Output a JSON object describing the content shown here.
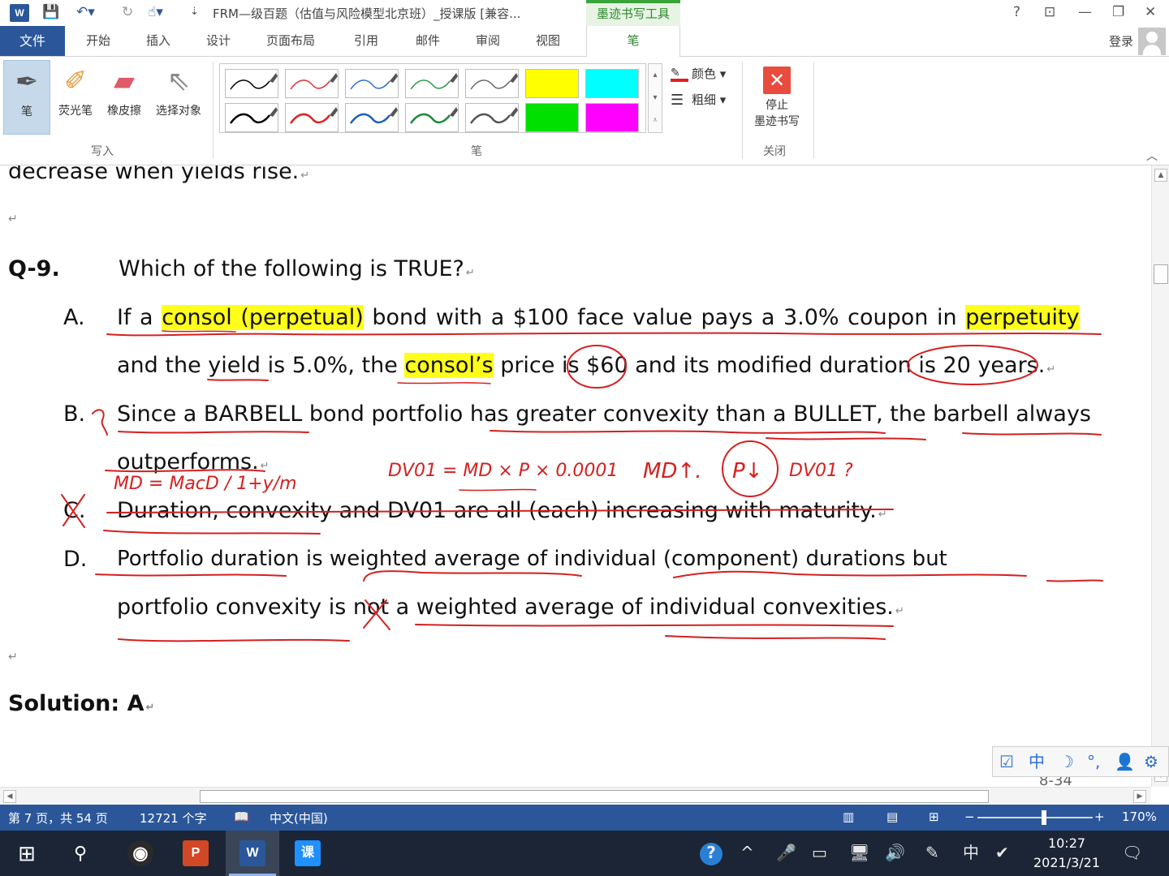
{
  "titlebar": {
    "app_icon": "W",
    "title": "FRM—级百题（估值与风险模型北京班）_授课版 [兼容...",
    "context_tab": "墨迹书写工具",
    "help": "?",
    "ribbon_options": "⊡",
    "minimize": "—",
    "restore": "❐",
    "close": "✕"
  },
  "tabs": {
    "file": "文件",
    "items": [
      "开始",
      "插入",
      "设计",
      "页面布局",
      "引用",
      "邮件",
      "审阅",
      "视图"
    ],
    "active": "笔",
    "signin": "登录"
  },
  "ribbon": {
    "write_tools": [
      {
        "label": "笔",
        "icon": "pen-icon"
      },
      {
        "label": "荧光笔",
        "icon": "highlighter-icon"
      },
      {
        "label": "橡皮擦",
        "icon": "eraser-icon"
      },
      {
        "label": "选择对象",
        "icon": "select-cursor-icon"
      }
    ],
    "write_group": "写入",
    "pens_group": "笔",
    "pen_colors_top": [
      "#000000",
      "#e03030",
      "#2f6fd0",
      "#2f9a4a",
      "#6a6a6a"
    ],
    "pen_colors_bottom": [
      "#000000",
      "#e02020",
      "#1f5fbf",
      "#1a8a3a",
      "#555555"
    ],
    "highlighters_top": [
      "#ffff00",
      "#00ffff"
    ],
    "highlighters_bottom": [
      "#00e000",
      "#ff00ff"
    ],
    "color_cmd": "颜色",
    "thickness_cmd": "粗细",
    "stop_line1": "停止",
    "stop_line2": "墨迹书写",
    "close_group": "关闭"
  },
  "document": {
    "line_prev": "decrease when yields rise.",
    "q_label": "Q-9.",
    "q_text": "Which of the following is TRUE?",
    "a_label": "A.",
    "a1_pre": "If a ",
    "a1_hl1": "consol (perpetual)",
    "a1_mid": " bond with a $100 face value pays a 3.0% coupon in ",
    "a1_hl2": "perpetuity",
    "a2_pre": "and the yield is 5.0%, the ",
    "a2_hl": "consol’s",
    "a2_post": " price is $60 and its modified duration is 20 years.",
    "b_label": "B.",
    "b1": "Since a BARBELL bond portfolio has greater convexity than a BULLET, the barbell always",
    "b2": "outperforms.",
    "c_label": "C.",
    "c1": "Duration, convexity and DV01 are all (each) increasing with maturity.",
    "d_label": "D.",
    "d1": "Portfolio  duration  is  weighted  average  of  individual  (component)  durations  but",
    "d2": "portfolio convexity is not a weighted average of individual convexities.",
    "solution": "Solution: A",
    "page_fragment": "8-34",
    "handwriting": {
      "note1": "MD = MacD / 1+y/m",
      "note2": "DV01 = MD × P × 0.0001",
      "note3": "MD↑.",
      "note4": "P↓",
      "note5": "DV01 ?"
    }
  },
  "ime": {
    "items": [
      "☑",
      "中",
      "☽",
      "°,",
      "👤",
      "⚙"
    ]
  },
  "statusbar": {
    "page": "第 7 页，共 54 页",
    "words": "12721 个字",
    "proof_icon": "proofing-icon",
    "language": "中文(中国)",
    "zoom_minus": "−",
    "zoom_plus": "+",
    "zoom": "170%",
    "zoom_fraction": 0.55
  },
  "taskbar": {
    "start_icon": "windows-icon",
    "search_icon": "search-icon",
    "apps": [
      {
        "name": "obs",
        "label": "◉",
        "color": "#2a2a2a"
      },
      {
        "name": "powerpoint",
        "label": "P",
        "color": "#d24726"
      },
      {
        "name": "word",
        "label": "W",
        "color": "#2b579a"
      },
      {
        "name": "ketang",
        "label": "课",
        "color": "#1e90ff"
      }
    ],
    "tray": [
      "?",
      "^",
      "🎤",
      "▭",
      "🖥",
      "🔊",
      "✎",
      "中",
      "✔"
    ],
    "time": "10:27",
    "date": "2021/3/21",
    "notify": "🗨"
  }
}
